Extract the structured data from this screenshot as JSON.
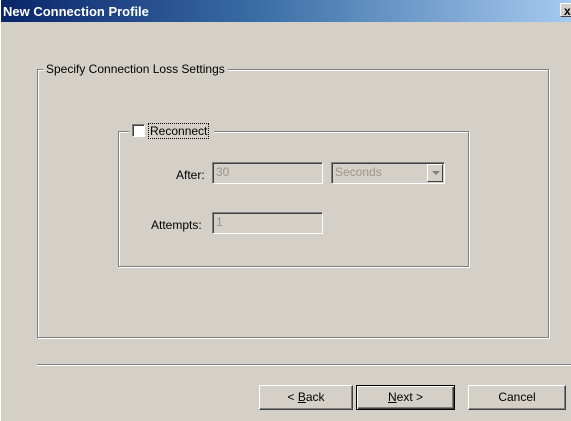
{
  "window": {
    "title": "New Connection Profile",
    "close_label": "x"
  },
  "loss_settings": {
    "legend": "Specify Connection Loss Settings"
  },
  "reconnect": {
    "checkbox_label": "Reconnect",
    "checked": false,
    "after_label": "After:",
    "after_value": "30",
    "after_unit": "Seconds",
    "attempts_label": "Attempts:",
    "attempts_value": "1"
  },
  "buttons": {
    "back_prefix": "< ",
    "back_mnemonic": "B",
    "back_rest": "ack",
    "next_mnemonic": "N",
    "next_rest": "ext >",
    "cancel": "Cancel"
  }
}
